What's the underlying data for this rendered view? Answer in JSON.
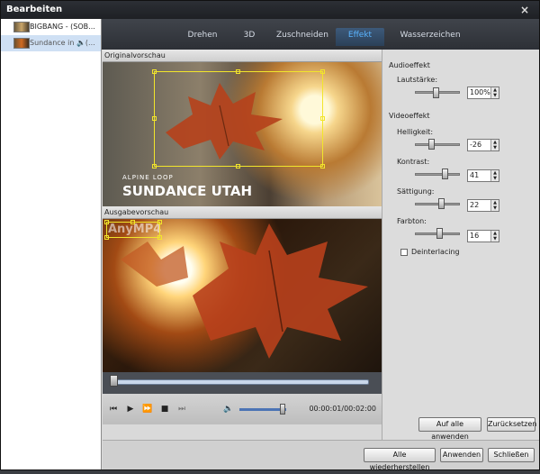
{
  "window": {
    "title": "Bearbeiten",
    "close_icon": "×"
  },
  "sidebar": {
    "items": [
      {
        "label": "BIGBANG - (SOB...",
        "selected": false
      },
      {
        "label": "Sundance in 🔈(...",
        "selected": true
      }
    ]
  },
  "tabs": [
    {
      "label": "Drehen",
      "active": false
    },
    {
      "label": "3D",
      "active": false
    },
    {
      "label": "Zuschneiden",
      "active": false
    },
    {
      "label": "Effekt",
      "active": true
    },
    {
      "label": "Wasserzeichen",
      "active": false
    }
  ],
  "preview": {
    "original_label": "Originalvorschau",
    "output_label": "Ausgabevorschau",
    "overlay_small": "ALPINE LOOP",
    "overlay_big": "SUNDANCE UTAH",
    "watermark_text": "AnyMP4"
  },
  "player": {
    "time": "00:00:01/00:02:00",
    "icons": {
      "prev": "⏮",
      "play": "▶",
      "forward": "⏩",
      "stop": "■",
      "next": "⏭",
      "volume": "🔈"
    },
    "volume_level": 0.9,
    "seek_position": 0.0
  },
  "audio": {
    "group_label": "Audioeffekt",
    "volume_label": "Lautstärke:",
    "volume_value": "100%"
  },
  "video": {
    "group_label": "Videoeffekt",
    "brightness_label": "Helligkeit:",
    "brightness_value": "-26",
    "contrast_label": "Kontrast:",
    "contrast_value": "41",
    "saturation_label": "Sättigung:",
    "saturation_value": "22",
    "hue_label": "Farbton:",
    "hue_value": "16",
    "deinterlace_label": "Deinterlacing",
    "deinterlace_checked": false
  },
  "buttons": {
    "apply_all": "Auf alle anwenden",
    "reset": "Zurücksetzen",
    "restore_all": "Alle wiederherstellen",
    "apply": "Anwenden",
    "close": "Schließen"
  }
}
